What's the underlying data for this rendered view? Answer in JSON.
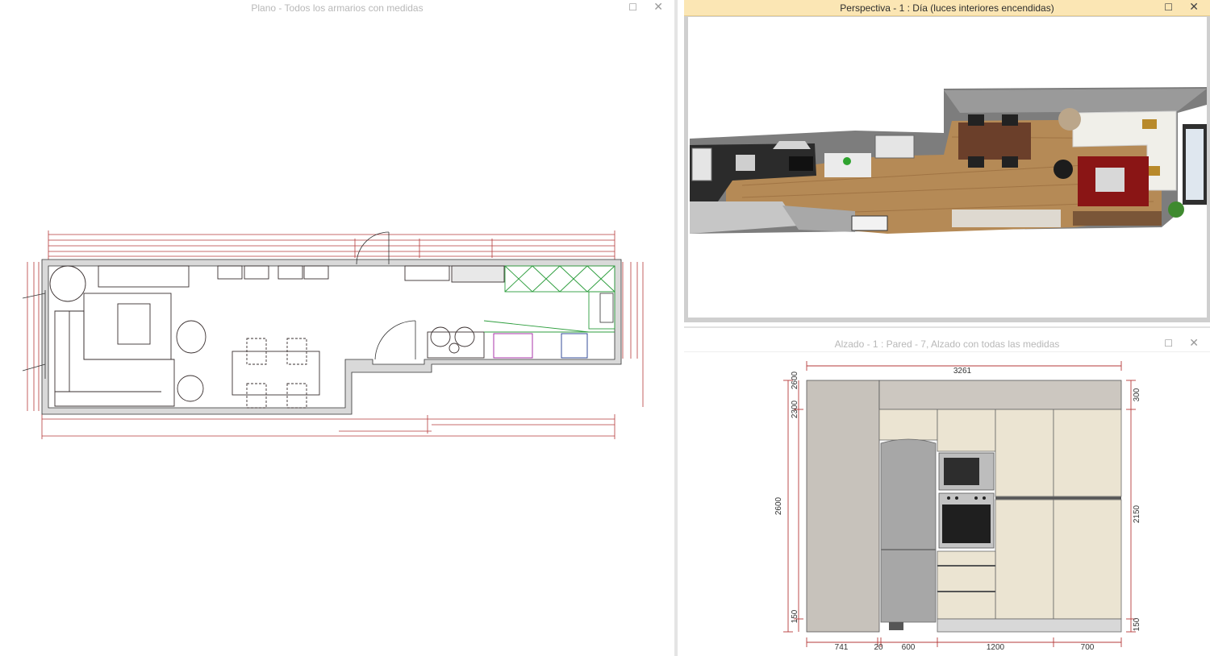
{
  "plan": {
    "title": "Plano - Todos los armarios con medidas"
  },
  "perspective": {
    "title": "Perspectiva - 1 : Día (luces interiores encendidas)"
  },
  "elevation": {
    "title": "Alzado - 1 : Pared - 7, Alzado con todas las medidas",
    "dims": {
      "top_total": "3261",
      "left_outer": "2600",
      "left_inner_top": "2600",
      "left_mid": "2300",
      "left_bottom": "150",
      "right_top": "300",
      "right_mid": "2150",
      "right_bottom": "150",
      "bottom_1": "741",
      "bottom_2": "20",
      "bottom_3": "600",
      "bottom_4": "1200",
      "bottom_5": "700"
    }
  },
  "window_buttons": {
    "maximize": "☐",
    "close": "✕"
  },
  "colors": {
    "active_title": "#fbe6b4",
    "dimension_red": "#b53a3a",
    "cabinet_green": "#2e9e3e"
  }
}
